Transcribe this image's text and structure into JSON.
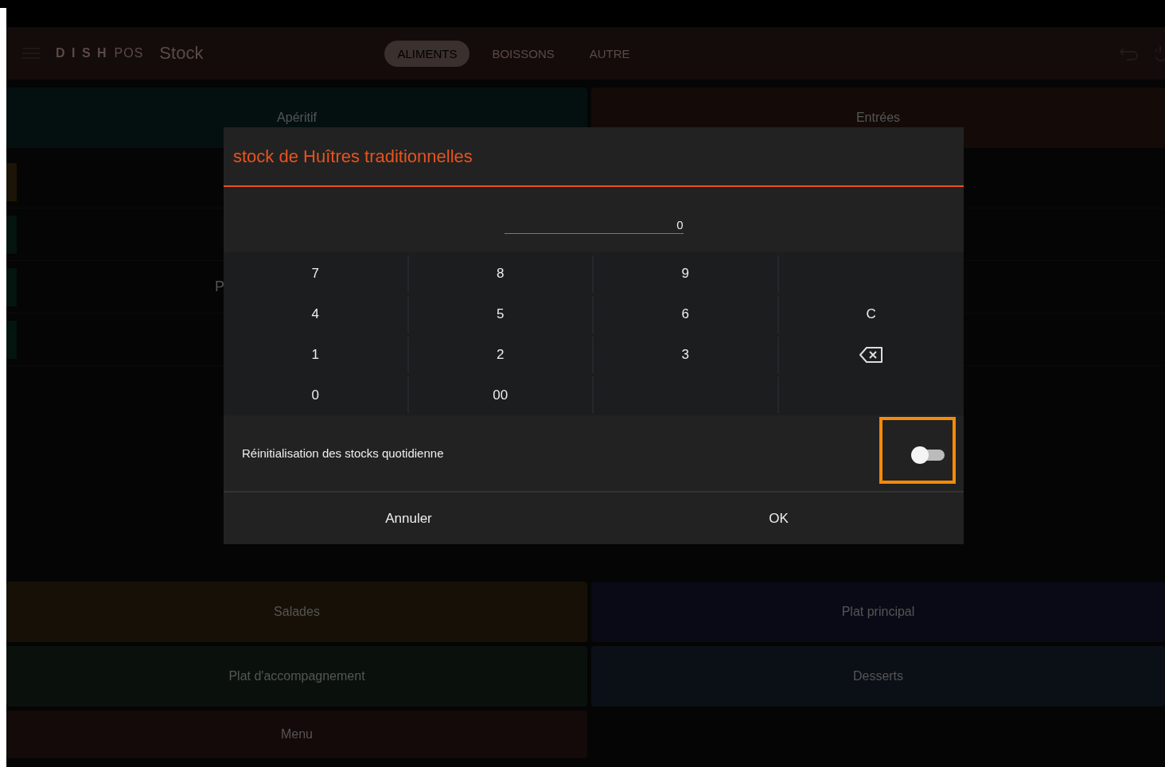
{
  "header": {
    "logo_brand": "D I S H",
    "logo_suffix": "POS",
    "title": "Stock",
    "tabs": [
      {
        "label": "ALIMENTS",
        "selected": true
      },
      {
        "label": "BOISSONS",
        "selected": false
      },
      {
        "label": "AUTRE",
        "selected": false
      }
    ]
  },
  "categories_top": [
    {
      "label": "Apéritif",
      "color": "#04100f"
    },
    {
      "label": "Entrées",
      "color": "#140b09"
    }
  ],
  "list_rows": [
    {
      "color": "#1c1406",
      "label": ""
    },
    {
      "color": "#04140f",
      "label": ""
    },
    {
      "color": "#04140f",
      "label": "P"
    },
    {
      "color": "#04140f",
      "label": ""
    }
  ],
  "categories_bottom": [
    {
      "label": "Salades",
      "color": "#171006"
    },
    {
      "label": "Plat principal",
      "color": "#0a0a16"
    },
    {
      "label": "Plat d'accompagnement",
      "color": "#0a110d"
    },
    {
      "label": "Desserts",
      "color": "#0b0f16"
    },
    {
      "label": "Menu",
      "color": "#140a0a"
    }
  ],
  "dialog": {
    "title": "stock de Huîtres traditionnelles",
    "value": "0",
    "keys": [
      {
        "kind": "digit",
        "label": "7"
      },
      {
        "kind": "digit",
        "label": "8"
      },
      {
        "kind": "digit",
        "label": "9"
      },
      {
        "kind": "empty"
      },
      {
        "kind": "digit",
        "label": "4"
      },
      {
        "kind": "digit",
        "label": "5"
      },
      {
        "kind": "digit",
        "label": "6"
      },
      {
        "kind": "digit",
        "label": "C"
      },
      {
        "kind": "digit",
        "label": "1"
      },
      {
        "kind": "digit",
        "label": "2"
      },
      {
        "kind": "digit",
        "label": "3"
      },
      {
        "kind": "backspace"
      },
      {
        "kind": "digit",
        "label": "0"
      },
      {
        "kind": "digit",
        "label": "00"
      },
      {
        "kind": "empty"
      },
      {
        "kind": "empty"
      }
    ],
    "toggle": {
      "label": "Réinitialisation des stocks quotidienne",
      "on": false,
      "highlighted": true
    },
    "buttons": [
      "Annuler",
      "OK"
    ]
  }
}
